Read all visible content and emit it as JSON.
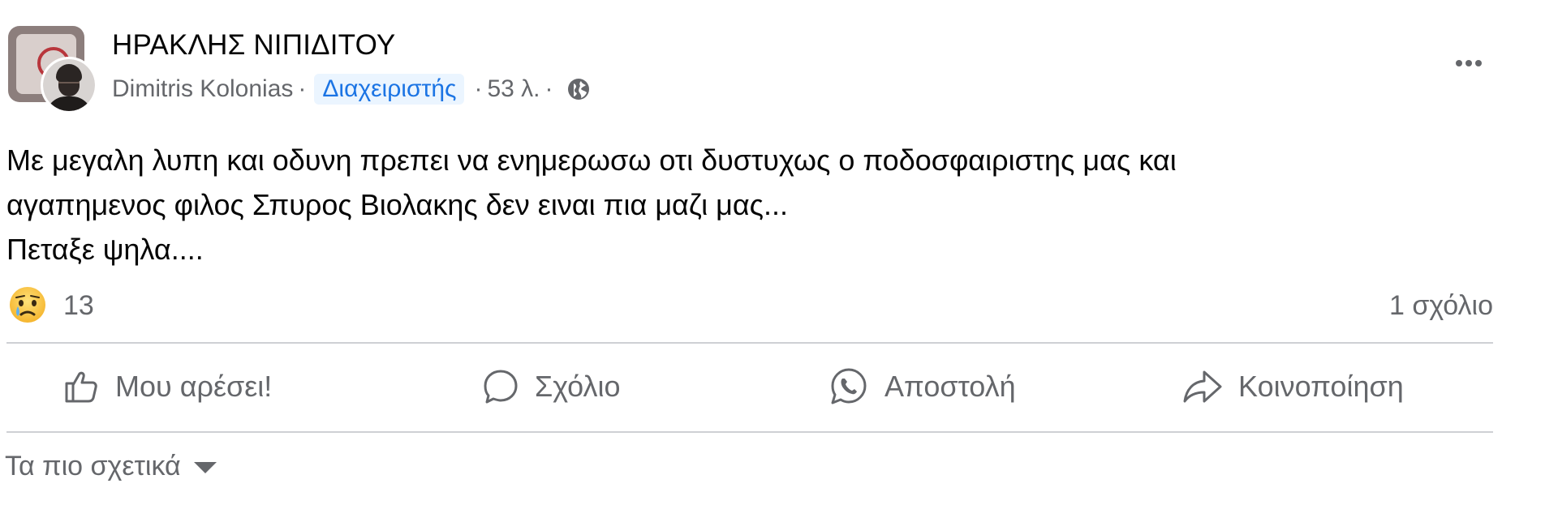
{
  "post": {
    "group_name": "ΗΡΑΚΛΗΣ ΝΙΠΙΔΙΤΟΥ",
    "author": "Dimitris Kolonias",
    "separator": "·",
    "role_badge": "Διαχειριστής",
    "time": "53 λ.",
    "privacy_icon": "globe-icon",
    "body_lines": [
      "Με μεγαλη λυπη και οδυνη πρεπει να ενημερωσω οτι δυστυχως ο ποδοσφαιριστης μας και",
      "αγαπημενος φιλος Σπυρος Βιολακης δεν ειναι πια μαζι μας...",
      "Πεταξε ψηλα...."
    ],
    "reaction_icon": "sad-crying-emoji",
    "reaction_count": "13",
    "comments_count": "1 σχόλιο"
  },
  "actions": {
    "like_label": "Μου αρέσει!",
    "comment_label": "Σχόλιο",
    "send_label": "Αποστολή",
    "share_label": "Κοινοποίηση"
  },
  "comments_filter": {
    "label": "Τα πιο σχετικά"
  },
  "colors": {
    "primary_text": "#050505",
    "secondary_text": "#65676b",
    "badge_bg": "#ebf5ff",
    "badge_text": "#1b74e4",
    "divider": "#ced0d4"
  }
}
